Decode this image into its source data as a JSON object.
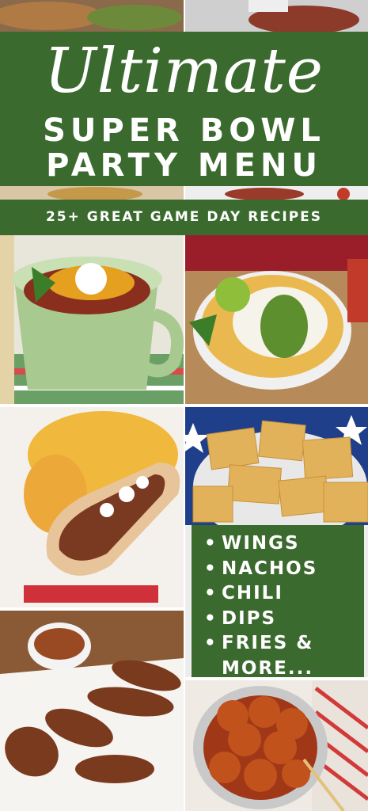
{
  "header": {
    "script_title": "Ultimate",
    "line1": "SUPER BOWL",
    "line2": "PARTY MENU"
  },
  "subtitle": "25+ GREAT GAME DAY RECIPES",
  "list": {
    "bullet": "•",
    "items": [
      "WINGS",
      "NACHOS",
      "CHILI",
      "DIPS",
      "FRIES &",
      "MORE..."
    ]
  },
  "colors": {
    "green": "#3b6a2e",
    "text": "#ffffff"
  }
}
